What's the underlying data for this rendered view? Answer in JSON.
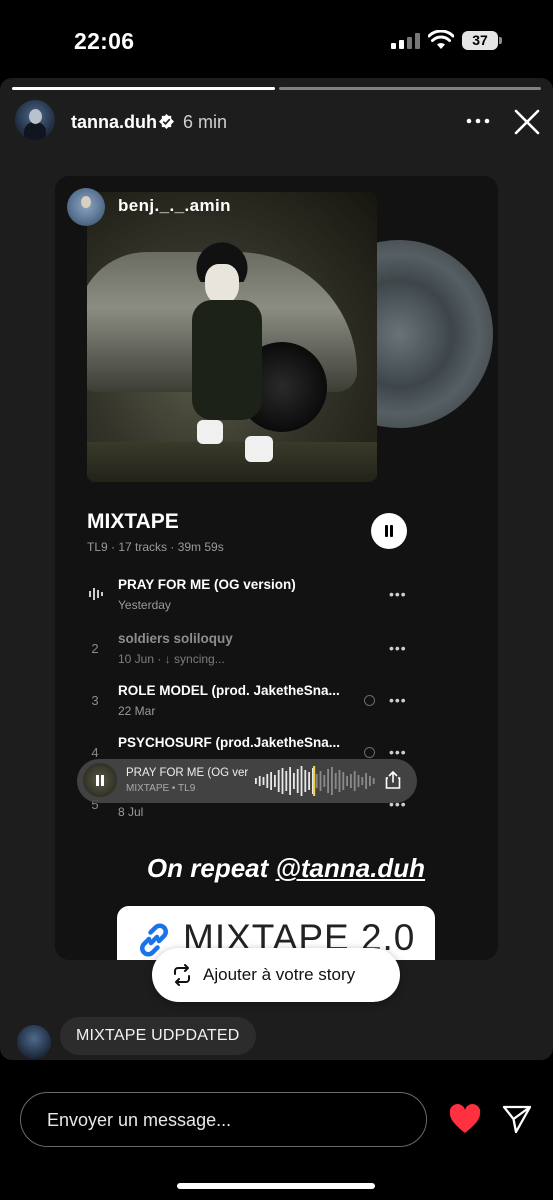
{
  "status_bar": {
    "time": "22:06",
    "battery": "37",
    "icons": [
      "signal-icon",
      "wifi-icon",
      "battery-icon"
    ]
  },
  "story": {
    "username": "tanna.duh",
    "time_ago": "6 min",
    "progress_segments": 2,
    "active_segment": 1
  },
  "shared_post": {
    "sharer": "benj._._.amin",
    "album": {
      "title": "MIXTAPE",
      "meta": "TL9 · 17 tracks · 39m 59s"
    },
    "tracks": [
      {
        "num": "",
        "title": "PRAY FOR ME (OG version)",
        "sub": "Yesterday",
        "playing": true
      },
      {
        "num": "2",
        "title": "soldiers soliloquy",
        "sub": "10 Jun · ↓ syncing...",
        "dim": true
      },
      {
        "num": "3",
        "title": "ROLE MODEL (prod. JaketheSna...",
        "sub": "22 Mar",
        "globe": true
      },
      {
        "num": "4",
        "title": "PSYCHOSURF (prod.JaketheSna...",
        "sub": "",
        "globe": true
      },
      {
        "num": "5",
        "title": "",
        "sub": "8 Jul"
      }
    ],
    "mini_player": {
      "title": "PRAY FOR ME (OG versi",
      "sub": "MIXTAPE • TL9"
    }
  },
  "caption": {
    "prefix": "On repeat ",
    "mention": "@tanna.duh"
  },
  "link_sticker": {
    "text": "MIXTAPE 2.0"
  },
  "add_to_story": "Ajouter à votre story",
  "reply": {
    "text": "MIXTAPE UDPDATED"
  },
  "composer": {
    "placeholder": "Envoyer un message..."
  },
  "colors": {
    "heart": "#ff3040",
    "waveform_marker": "#f2d23c",
    "background": "#000000"
  }
}
